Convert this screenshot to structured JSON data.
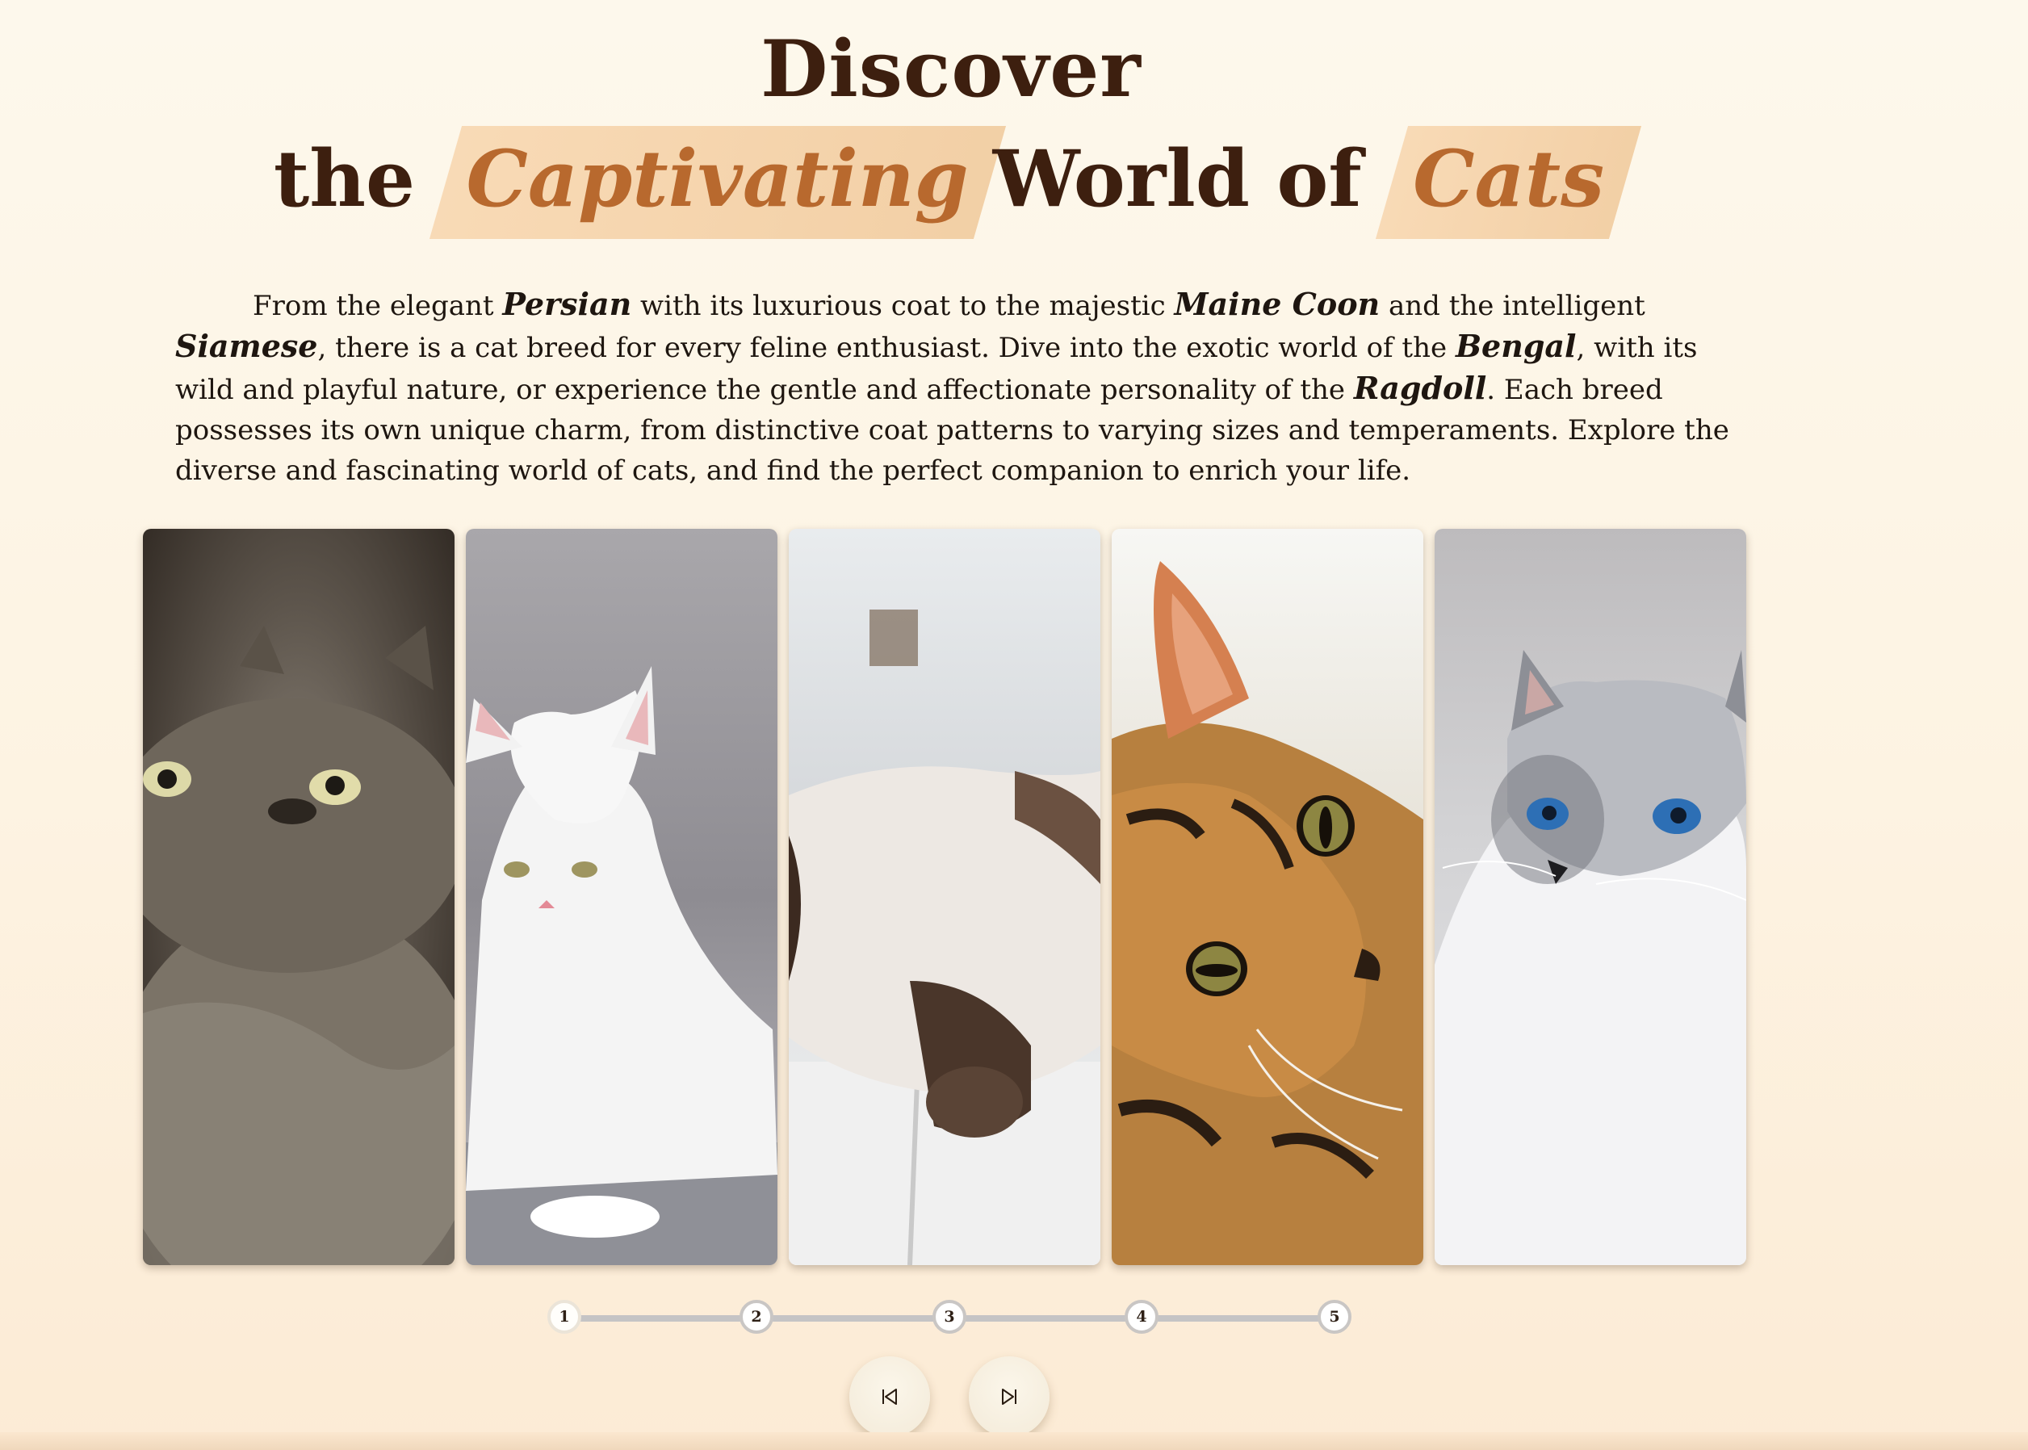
{
  "header": {
    "line1": "Discover",
    "the": "the",
    "highlight1": "Captivating",
    "world_of": "World of",
    "highlight2": "Cats"
  },
  "intro": {
    "t1": "From the elegant ",
    "persian": "Persian",
    "t2": " with its luxurious coat to the majestic ",
    "maine_coon": "Maine Coon",
    "t3": " and the intelligent ",
    "siamese": "Siamese",
    "t4": ", there is a cat breed for every feline enthusiast. Dive into the exotic world of the ",
    "bengal": "Bengal",
    "t5": ", with its wild and playful nature, or experience the gentle and affectionate personality of the ",
    "ragdoll": "Ragdoll",
    "t6": ". Each breed possesses its own unique charm, from distinctive coat patterns to varying sizes and temperaments. Explore the diverse and fascinating world of cats, and find the perfect companion to enrich your life."
  },
  "gallery": {
    "panels": [
      "persian-photo",
      "maine-coon-photo",
      "siamese-photo",
      "bengal-photo",
      "ragdoll-photo"
    ]
  },
  "stepper": {
    "steps": [
      "1",
      "2",
      "3",
      "4",
      "5"
    ],
    "active": 1
  },
  "controls": {
    "prev_icon": "skip-back-icon",
    "next_icon": "skip-forward-icon"
  },
  "colors": {
    "title": "#3d1f0f",
    "highlight_text": "#b8692e",
    "highlight_bg": "#f1cb9e",
    "background": "#fdf6e8"
  }
}
